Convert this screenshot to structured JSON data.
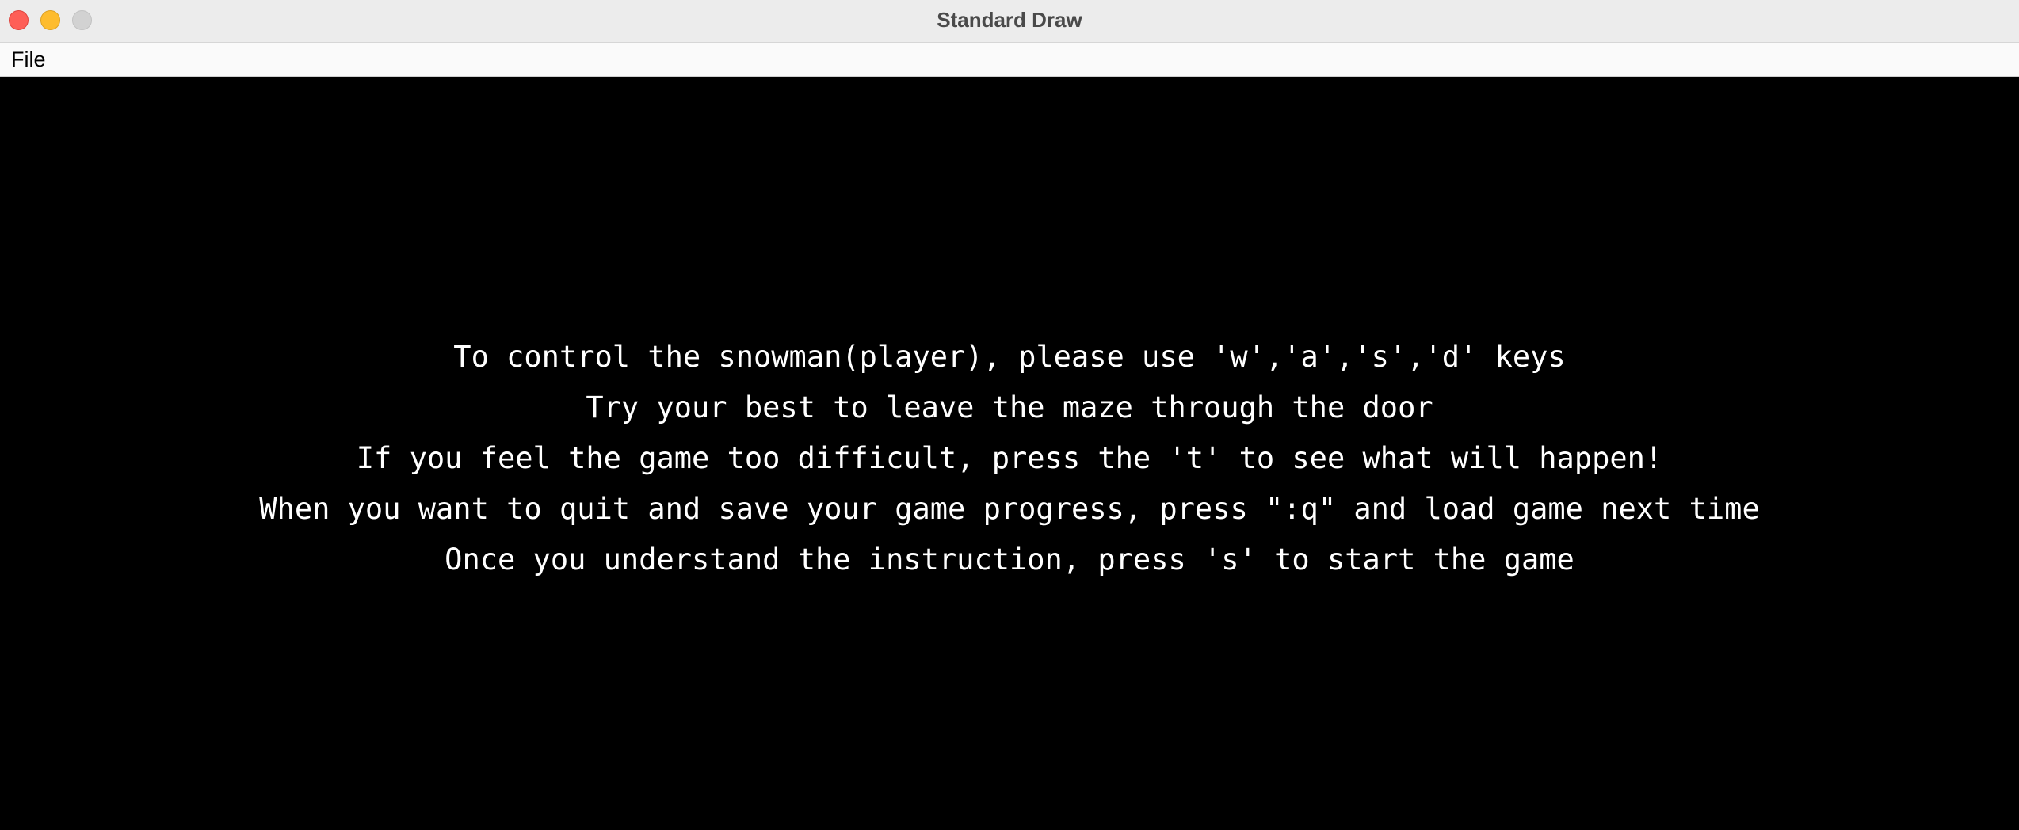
{
  "window": {
    "title": "Standard Draw"
  },
  "menubar": {
    "items": [
      {
        "label": "File"
      }
    ]
  },
  "canvas": {
    "background": "#000000",
    "text_color": "#ffffff",
    "instructions": [
      "To control the snowman(player), please use 'w','a','s','d' keys",
      "Try your best to leave the maze through the door",
      "If you feel the game too difficult, press the 't' to see what will happen!",
      "When you want to quit and save your game progress, press \":q\" and load game next time",
      "Once you understand the instruction, press 's' to start the game"
    ]
  }
}
